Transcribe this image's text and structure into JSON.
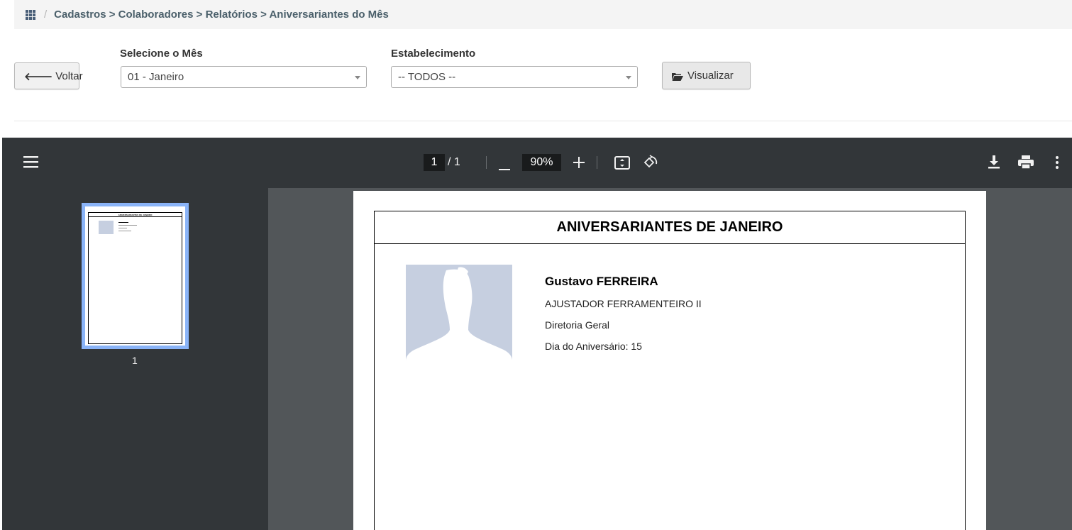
{
  "breadcrumb": {
    "text": "Cadastros > Colaboradores > Relatórios > Aniversariantes do Mês",
    "separator": "/"
  },
  "form": {
    "back_label": "Voltar",
    "month_label": "Selecione o Mês",
    "month_value": "01 - Janeiro",
    "establishment_label": "Estabelecimento",
    "establishment_value": "-- TODOS --",
    "view_label": "Visualizar"
  },
  "pdf_viewer": {
    "current_page": "1",
    "page_total": "/ 1",
    "zoom": "90%",
    "thumbnail_page_number": "1",
    "icons": [
      "menu-icon",
      "zoom-out-icon",
      "zoom-in-icon",
      "fit-page-icon",
      "rotate-icon",
      "download-icon",
      "print-icon",
      "more-options-icon"
    ]
  },
  "report": {
    "title": "ANIVERSARIANTES DE JANEIRO",
    "employee": {
      "name": "Gustavo FERREIRA",
      "role": "AJUSTADOR FERRAMENTEIRO II",
      "department": "Diretoria Geral",
      "birthday": "Dia do Aniversário: 15"
    }
  },
  "colors": {
    "breadcrumb_bg": "#f4f4f4",
    "breadcrumb_text": "#4a5f6a",
    "viewer_toolbar": "#323639",
    "viewer_bg": "#525659",
    "thumbnail_highlight": "#8ab4f8",
    "photo_placeholder": "#c6cfe0"
  }
}
